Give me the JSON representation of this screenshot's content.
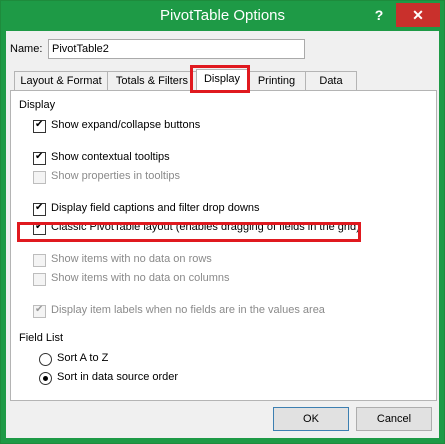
{
  "window": {
    "title": "PivotTable Options",
    "help_label": "?",
    "close_label": "✕"
  },
  "name": {
    "label": "Name:",
    "value": "PivotTable2"
  },
  "tabs": [
    {
      "label": "Layout & Format"
    },
    {
      "label": "Totals & Filters"
    },
    {
      "label": "Display"
    },
    {
      "label": "Printing"
    },
    {
      "label": "Data"
    }
  ],
  "display": {
    "section_label": "Display",
    "options": [
      {
        "label": "Show expand/collapse buttons",
        "checked": true,
        "enabled": true
      },
      {
        "label": "Show contextual tooltips",
        "checked": true,
        "enabled": true
      },
      {
        "label": "Show properties in tooltips",
        "checked": false,
        "enabled": false
      },
      {
        "label": "Display field captions and filter drop downs",
        "checked": true,
        "enabled": true
      },
      {
        "label": "Classic PivotTable layout (enables dragging of fields in the grid)",
        "checked": true,
        "enabled": true
      },
      {
        "label": "Show items with no data on rows",
        "checked": false,
        "enabled": false
      },
      {
        "label": "Show items with no data on columns",
        "checked": false,
        "enabled": false
      },
      {
        "label": "Display item labels when no fields are in the values area",
        "checked": true,
        "enabled": false
      }
    ]
  },
  "field_list": {
    "section_label": "Field List",
    "options": [
      {
        "label": "Sort A to Z",
        "selected": false
      },
      {
        "label": "Sort in data source order",
        "selected": true
      }
    ]
  },
  "buttons": {
    "ok": "OK",
    "cancel": "Cancel"
  }
}
